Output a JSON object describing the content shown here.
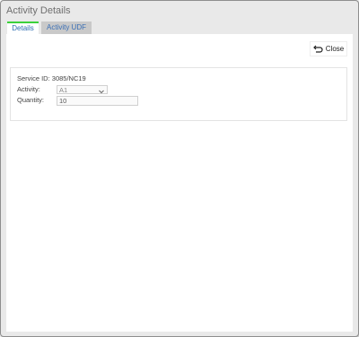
{
  "window": {
    "title": "Activity Details"
  },
  "tabs": [
    {
      "label": "Details",
      "active": true
    },
    {
      "label": "Activity UDF",
      "active": false
    }
  ],
  "toolbar": {
    "close_label": "Close",
    "close_icon": "undo-arrow-icon"
  },
  "form": {
    "service_id_label": "Service ID:",
    "service_id_value": "3085/NC19",
    "activity_label": "Activity:",
    "activity_value": "A1",
    "quantity_label": "Quantity:",
    "quantity_value": "10"
  },
  "colors": {
    "active_tab_accent": "#3bd13b",
    "tab_text": "#2b6cb0",
    "window_bg": "#e9e9e9"
  }
}
